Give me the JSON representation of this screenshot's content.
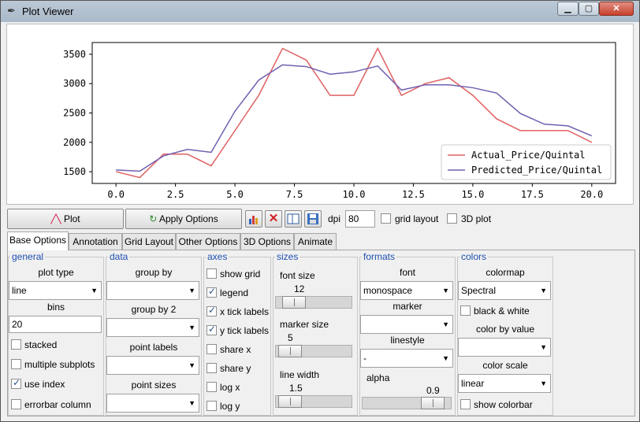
{
  "window": {
    "title": "Plot Viewer",
    "minimize": "▁",
    "maximize": "▢",
    "close": "✕"
  },
  "chart_data": {
    "type": "line",
    "x": [
      0,
      1,
      2,
      3,
      4,
      5,
      6,
      7,
      8,
      9,
      10,
      11,
      12,
      13,
      14,
      15,
      16,
      17,
      18,
      19,
      20
    ],
    "series": [
      {
        "name": "Actual_Price/Quintal",
        "color": "#e06060",
        "values": [
          1500,
          1400,
          1800,
          1800,
          1600,
          2200,
          2800,
          3600,
          3400,
          2800,
          2800,
          3600,
          2800,
          3000,
          3100,
          2800,
          2400,
          2200,
          2200,
          2200,
          2000
        ]
      },
      {
        "name": "Predicted_Price/Quintal",
        "color": "#7060b0",
        "values": [
          1530,
          1510,
          1770,
          1880,
          1830,
          2530,
          3060,
          3320,
          3290,
          3160,
          3200,
          3300,
          2890,
          2980,
          2980,
          2930,
          2840,
          2490,
          2310,
          2280,
          2110
        ]
      }
    ],
    "xticks": [
      "0.0",
      "2.5",
      "5.0",
      "7.5",
      "10.0",
      "12.5",
      "15.0",
      "17.5",
      "20.0"
    ],
    "xtick_values": [
      0,
      2.5,
      5,
      7.5,
      10,
      12.5,
      15,
      17.5,
      20
    ],
    "yticks": [
      "1500",
      "2000",
      "2500",
      "3000",
      "3500"
    ],
    "ytick_values": [
      1500,
      2000,
      2500,
      3000,
      3500
    ],
    "xlim": [
      -1,
      21
    ],
    "ylim": [
      1300,
      3700
    ],
    "legend": "bottom-right",
    "grid": false
  },
  "toolbar": {
    "plot_label": "Plot",
    "apply_label": "Apply Options",
    "dpi_label": "dpi",
    "dpi_value": "80",
    "grid_layout_label": "grid layout",
    "plot3d_label": "3D plot"
  },
  "tabs": [
    "Base Options",
    "Annotation",
    "Grid Layout",
    "Other Options",
    "3D Options",
    "Animate"
  ],
  "general": {
    "title": "general",
    "plot_type_label": "plot type",
    "plot_type_value": "line",
    "bins_label": "bins",
    "bins_value": "20",
    "stacked": "stacked",
    "multiple_subplots": "multiple subplots",
    "use_index": "use index",
    "errorbar_column": "errorbar column"
  },
  "data": {
    "title": "data",
    "group_by": "group by",
    "group_by_2": "group by 2",
    "point_labels": "point labels",
    "point_sizes": "point sizes"
  },
  "axes": {
    "title": "axes",
    "items": [
      "show grid",
      "legend",
      "x tick labels",
      "y tick labels",
      "share x",
      "share y",
      "log x",
      "log y"
    ],
    "checked": [
      false,
      true,
      true,
      true,
      false,
      false,
      false,
      false
    ]
  },
  "sizes": {
    "title": "sizes",
    "font_size_label": "font size",
    "font_size_value": "12",
    "font_size_level": 0.12,
    "marker_size_label": "marker size",
    "marker_size_value": "5",
    "marker_size_level": 0.05,
    "line_width_label": "line width",
    "line_width_value": "1.5",
    "line_width_level": 0.05
  },
  "formats": {
    "title": "formats",
    "font_label": "font",
    "font_value": "monospace",
    "marker_label": "marker",
    "marker_value": "",
    "linestyle_label": "linestyle",
    "linestyle_value": "-",
    "alpha_label": "alpha",
    "alpha_value": "0.9",
    "alpha_level": 0.9
  },
  "colors": {
    "title": "colors",
    "colormap_label": "colormap",
    "colormap_value": "Spectral",
    "black_white": "black & white",
    "color_by_value": "color by value",
    "color_scale_label": "color scale",
    "color_scale_value": "linear",
    "show_colorbar": "show colorbar"
  }
}
